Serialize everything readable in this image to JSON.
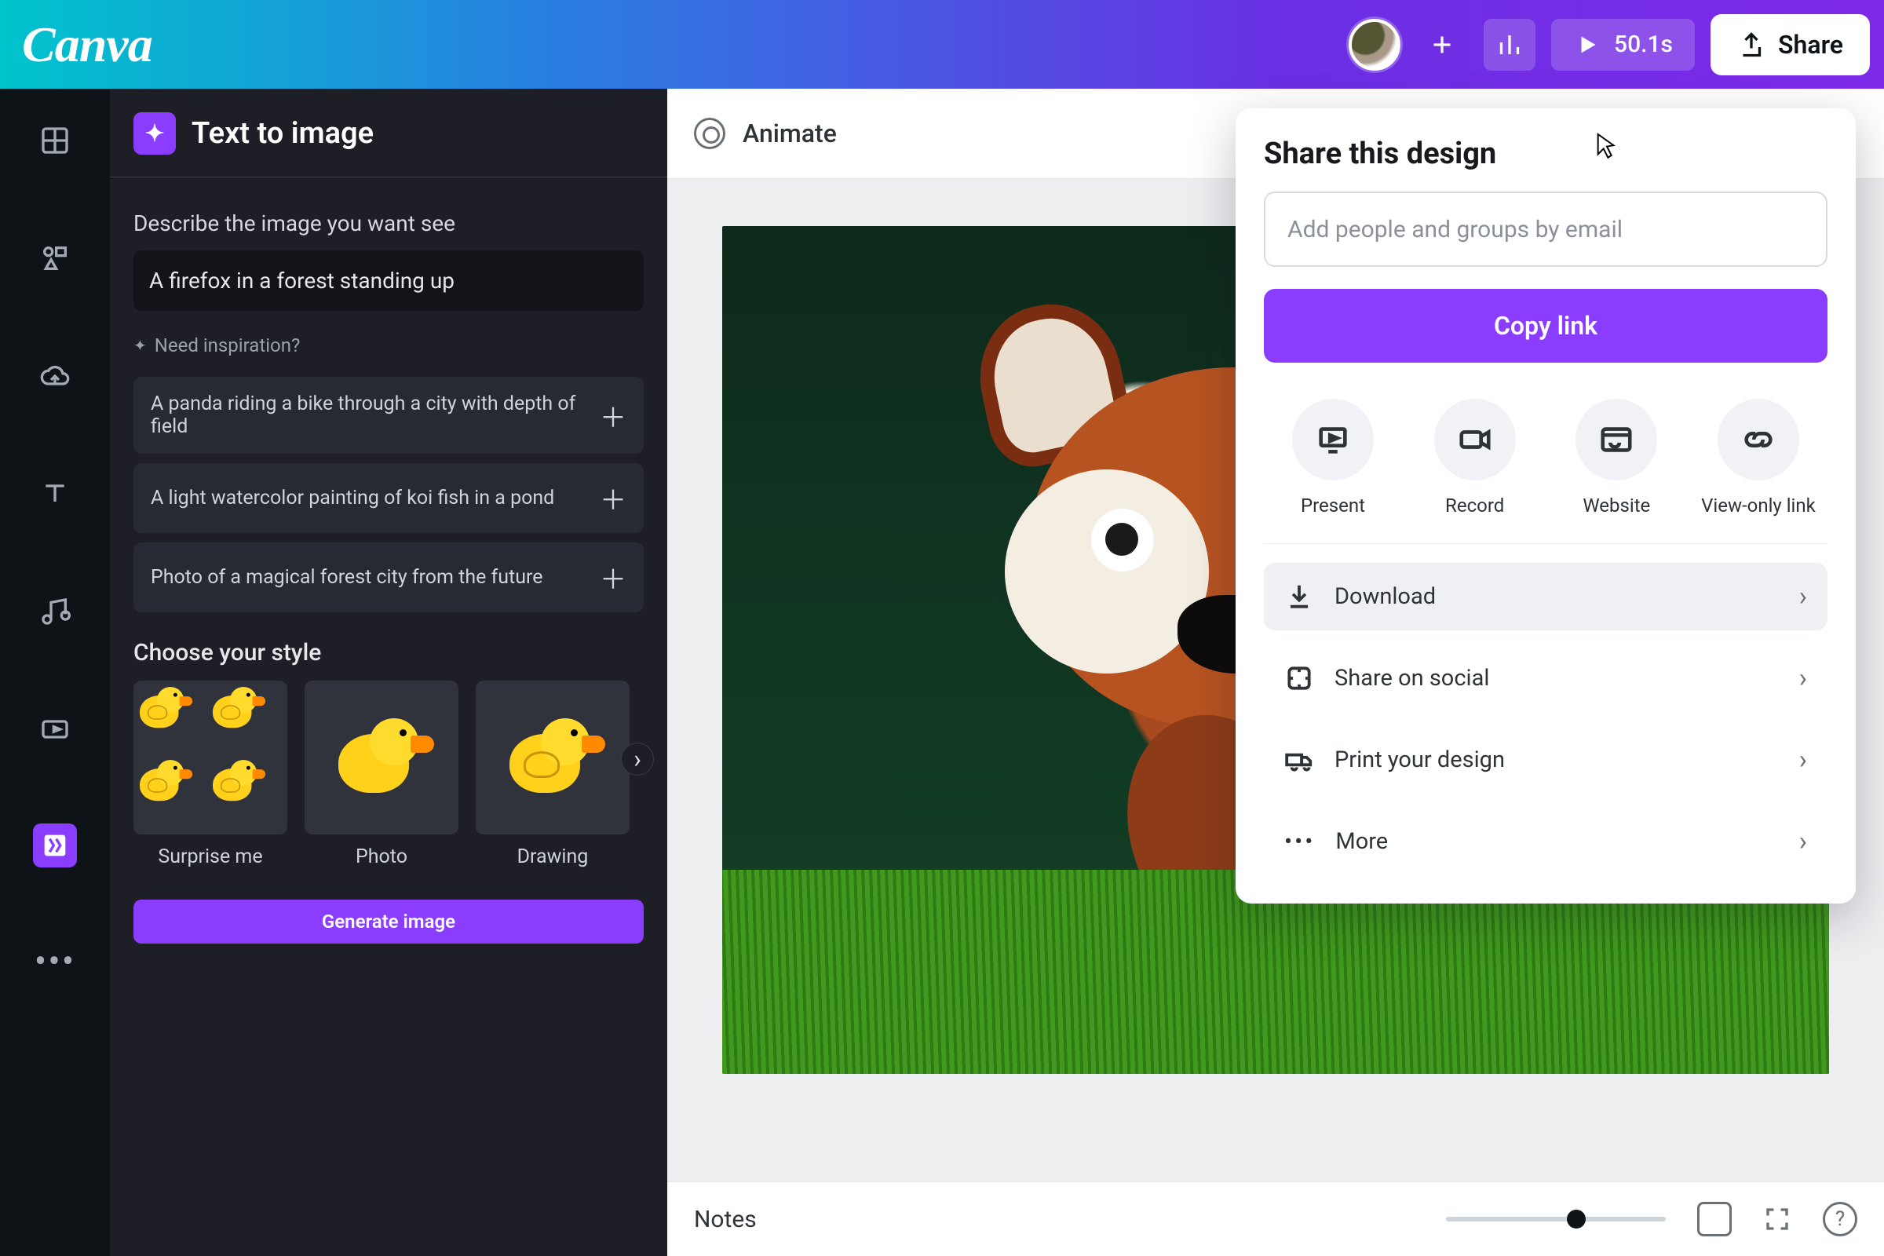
{
  "topbar": {
    "logo": "Canva",
    "duration": "50.1s",
    "share": "Share"
  },
  "panel": {
    "title": "Text to image",
    "describe_label": "Describe the image you want see",
    "prompt": "A firefox in a forest standing up",
    "inspiration_label": "Need inspiration?",
    "suggestions": [
      "A panda riding a bike through a city with depth of field",
      "A light watercolor painting of koi fish in a pond",
      "Photo of a magical forest city from the future"
    ],
    "style_label": "Choose your style",
    "styles": [
      "Surprise me",
      "Photo",
      "Drawing"
    ],
    "generate": "Generate image"
  },
  "docbar": {
    "animate": "Animate"
  },
  "bottombar": {
    "notes": "Notes"
  },
  "popover": {
    "title": "Share this design",
    "placeholder": "Add people and groups by email",
    "copy": "Copy link",
    "actions": [
      "Present",
      "Record",
      "Website",
      "View-only link"
    ],
    "rows": [
      "Download",
      "Share on social",
      "Print your design",
      "More"
    ]
  }
}
